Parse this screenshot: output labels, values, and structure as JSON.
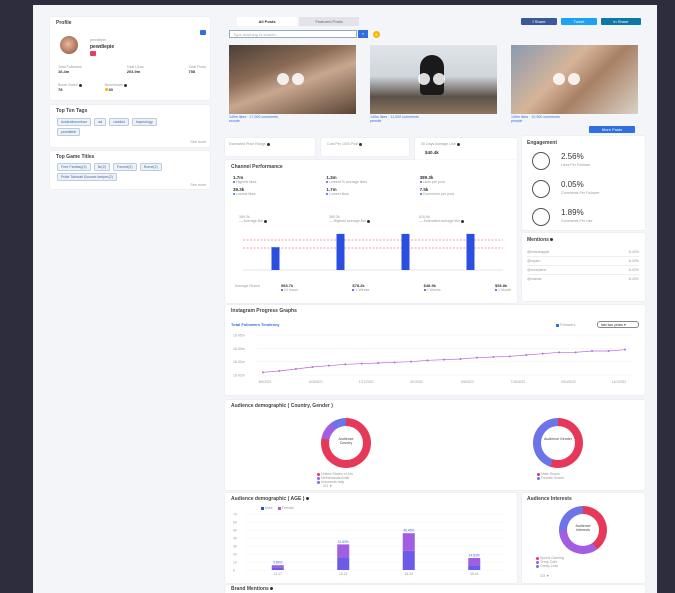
{
  "profile": {
    "heading": "Profile",
    "handle": "pewdiepie",
    "stats": [
      {
        "label": "Total Followers",
        "value": "16.4m"
      },
      {
        "label": "Total Likes",
        "value": "203.9m"
      },
      {
        "label": "Total Posts",
        "value": "758"
      }
    ],
    "scores": [
      {
        "label": "Boost Score",
        "value": "78"
      },
      {
        "label": "Benchmark",
        "value": "60"
      }
    ]
  },
  "top_tags": {
    "heading": "Top Ten Tags",
    "tags": [
      "#videoliveontour",
      "ad",
      "nzddist",
      "trapnology",
      "pewdiebit"
    ],
    "more": "See more"
  },
  "top_game_titles": {
    "heading": "Top Game Titles",
    "titles": [
      "Free Fantasy(3)",
      "Nr(2)",
      "Forced(2)",
      "Rome(2)",
      "Pride Tahrirah Bounce keeper(2)"
    ],
    "more": "See more"
  },
  "posts": {
    "tabs": [
      "All Posts",
      "Featured Posts"
    ],
    "search_placeholder": "Type anything to search...",
    "search_badge": "6",
    "share_buttons": [
      "f Share",
      "Tweet",
      "in Share"
    ],
    "items": [
      {
        "caption": "140m likes · 17,000 comments",
        "sub": "ecoute"
      },
      {
        "caption": "140m likes · 11,000 comments",
        "sub": "pewdie"
      },
      {
        "caption": "140m likes · 10,900 comments",
        "sub": "pewpie"
      }
    ],
    "more_button": "More Posts"
  },
  "metrics_top": [
    {
      "label": "Estimated Price Range",
      "value": ""
    },
    {
      "label": "Cost Per 1000 Post",
      "value": ""
    },
    {
      "label": "30 Days Average Like",
      "value": "$40.4k"
    }
  ],
  "engagement": {
    "heading": "Engagement",
    "items": [
      {
        "value": "2.56%",
        "label": "Likes Per Follower"
      },
      {
        "value": "0.05%",
        "label": "Comments Per Follower"
      },
      {
        "value": "1.89%",
        "label": "Comments Per Like"
      }
    ]
  },
  "mentions": {
    "heading": "Mentions",
    "rows": [
      {
        "name": "@brianeapple",
        "value": "8.43%"
      },
      {
        "name": "@mpzm",
        "value": "8.43%"
      },
      {
        "name": "@zoreplane",
        "value": "8.43%"
      },
      {
        "name": "@marzia",
        "value": "8.43%"
      }
    ]
  },
  "channel_performance": {
    "heading": "Channel Performance",
    "stats": [
      {
        "value": "1.7m",
        "label": "Highest likes"
      },
      {
        "value": "1.3m",
        "label": "Lowest % average likes"
      },
      {
        "value": "389.3k",
        "label": "Likes per post"
      },
      {
        "value": "39.3k",
        "label": "Lowest likes"
      },
      {
        "value": "1.7m",
        "label": "Lowest likes"
      },
      {
        "value": "7.5k",
        "label": "Comments per post"
      }
    ],
    "bar_stats": [
      {
        "value": "389.3k",
        "label": "Average like"
      },
      {
        "value": "389.3k",
        "label": "Highest average like"
      },
      {
        "value": "610.6k",
        "label": "Estimated average like"
      }
    ],
    "bottom_label": "Average Reach",
    "legend": [
      {
        "value": "983.7k",
        "label": "24 hours"
      },
      {
        "value": "$78.2k",
        "label": "1 Weeks"
      },
      {
        "value": "$48.9k",
        "label": "3 Weeks"
      },
      {
        "value": "$93.8k",
        "label": "1 Month"
      }
    ]
  },
  "progress": {
    "heading": "Instagram Progress Graphs",
    "subheading": "Total Followers Tendency",
    "legend": "Followers",
    "dropdown": "last two years",
    "y_ticks": [
      "16.45m",
      "16.44m",
      "16.43m",
      "16.42m"
    ],
    "x_ticks": [
      "8/5/2021",
      "10/9/2021",
      "1/17/2022",
      "3/1/2022",
      "5/5/2022",
      "7/18/2022",
      "9/10/2022",
      "11/1/2022"
    ]
  },
  "demographics_country": {
    "heading": "Audience demographic ( Country, Gender )",
    "donut1": "Audience Country",
    "donut2": "Audience Gender",
    "legend1": [
      "United States of Am",
      "Netherlands Antill",
      "Indonesia Italy"
    ],
    "legend2": [
      "Male Suses",
      "Female Suses"
    ],
    "more": "2/3 ▼"
  },
  "demographics_age": {
    "heading": "Audience demographic ( AGE )",
    "legend": [
      "Male",
      "Female"
    ],
    "y_ticks": [
      "70",
      "60",
      "50",
      "40",
      "30",
      "20",
      "10",
      "0"
    ],
    "bars": [
      {
        "label": "13-17",
        "value": "5.89%"
      },
      {
        "label": "18-24",
        "value": "31.83%"
      },
      {
        "label": "25-34",
        "value": "46.45%"
      },
      {
        "label": "35-44",
        "value": "14.83%"
      }
    ]
  },
  "interests": {
    "heading": "Audience Interests",
    "donut": "Audience Interests",
    "legend": [
      "Sports Gaming",
      "Temp Cafe",
      "Camp Less"
    ],
    "more": "2/3 ▼"
  },
  "brand_mentions": {
    "heading": "Brand Mentions"
  },
  "colors": {
    "accent": "#2f6fe0",
    "bar": "#2a4fe0",
    "pink": "#e6395a",
    "purple": "#a15ee0",
    "line": "#b56ae0"
  },
  "chart_data": [
    {
      "type": "bar",
      "categories": [
        "24 hours",
        "1 Weeks",
        "3 Weeks",
        "1 Month"
      ],
      "values": [
        60,
        95,
        95,
        95
      ],
      "ylim": [
        0,
        100
      ]
    },
    {
      "type": "line",
      "title": "Total Followers Tendency",
      "series": [
        {
          "name": "Followers",
          "values": [
            16.422,
            16.423,
            16.4245,
            16.426,
            16.427,
            16.428,
            16.4285,
            16.429,
            16.4295,
            16.43,
            16.431,
            16.4315,
            16.432,
            16.433,
            16.4335,
            16.434,
            16.435,
            16.436,
            16.437,
            16.437,
            16.438,
            16.438,
            16.439
          ]
        }
      ],
      "ylim": [
        16.42,
        16.45
      ]
    },
    {
      "type": "bar",
      "title": "Audience demographic ( AGE )",
      "categories": [
        "13-17",
        "18-24",
        "25-34",
        "35-44"
      ],
      "series": [
        {
          "name": "Male",
          "values": [
            3,
            16,
            24,
            6
          ]
        },
        {
          "name": "Female",
          "values": [
            3,
            16,
            22,
            9
          ]
        }
      ],
      "ylim": [
        0,
        70
      ]
    }
  ]
}
